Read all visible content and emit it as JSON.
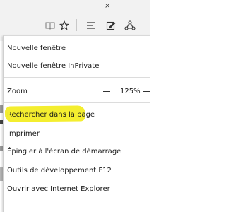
{
  "toolbar": {
    "reading_view_icon": "book-icon",
    "favorite_icon": "star-icon",
    "hub_icon": "hub-icon",
    "web_note_icon": "web-note-icon",
    "share_icon": "share-icon",
    "corner_close_glyph": "×"
  },
  "menu": {
    "new_window": "Nouvelle fenêtre",
    "new_inprivate": "Nouvelle fenêtre InPrivate",
    "zoom_label": "Zoom",
    "zoom_value": "125%",
    "find_on_page": "Rechercher dans la page",
    "print": "Imprimer",
    "pin_start": "Épingler à l'écran de démarrage",
    "dev_tools": "Outils de développement F12",
    "open_ie": "Ouvrir avec Internet Explorer"
  },
  "colors": {
    "highlight": "#f4ee2f",
    "menu_background": "#ffffff",
    "toolbar_background": "#f2f2f2"
  }
}
